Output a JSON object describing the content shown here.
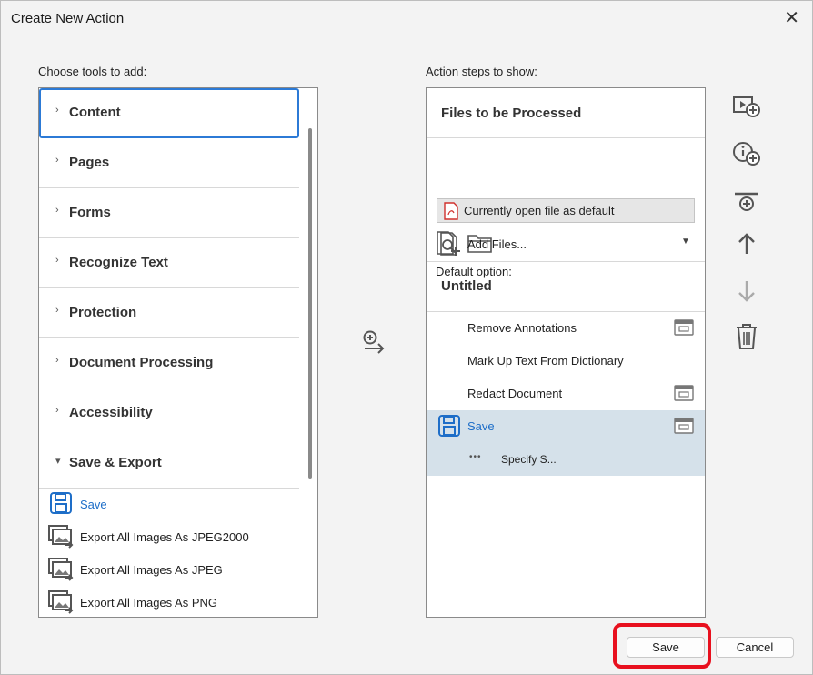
{
  "window": {
    "title": "Create New Action",
    "close_glyph": "✕"
  },
  "left": {
    "heading": "Choose tools to add:",
    "categories": [
      {
        "label": "Content",
        "state": "collapsed",
        "focused": true
      },
      {
        "label": "Pages",
        "state": "collapsed"
      },
      {
        "label": "Forms",
        "state": "collapsed"
      },
      {
        "label": "Recognize Text",
        "state": "collapsed"
      },
      {
        "label": "Protection",
        "state": "collapsed"
      },
      {
        "label": "Document Processing",
        "state": "collapsed"
      },
      {
        "label": "Accessibility",
        "state": "collapsed"
      },
      {
        "label": "Save & Export",
        "state": "expanded"
      }
    ],
    "chevron_collapsed": "›",
    "chevron_expanded": "▾",
    "tools": [
      {
        "label": "Save",
        "icon": "save-icon"
      },
      {
        "label": "Export All Images As JPEG2000",
        "icon": "export-images-icon"
      },
      {
        "label": "Export All Images As JPEG",
        "icon": "export-images-icon"
      },
      {
        "label": "Export All Images As PNG",
        "icon": "export-images-icon"
      }
    ]
  },
  "add_arrow_icon": "add-to-steps-icon",
  "right": {
    "heading": "Action steps to show:",
    "files_section": {
      "title": "Files to be Processed",
      "file_option": "Currently open file as default",
      "default_option_label": "Default option:",
      "default_option_value": "Add Files..."
    },
    "group_title": "Untitled",
    "steps": [
      {
        "label": "Remove Annotations",
        "dialog_icon": true
      },
      {
        "label": "Mark Up Text From Dictionary",
        "dialog_icon": false
      },
      {
        "label": "Redact Document",
        "dialog_icon": true
      },
      {
        "label": "Save",
        "dialog_icon": true,
        "selected": true
      }
    ],
    "sub_step": {
      "ellipsis": "•••",
      "label": "Specify S..."
    }
  },
  "side_icons": [
    "add-pause-icon",
    "add-instruction-icon",
    "add-panel-separator-icon",
    "move-up-icon",
    "move-down-icon",
    "delete-icon"
  ],
  "buttons": {
    "save": "Save",
    "cancel": "Cancel"
  },
  "colors": {
    "accent": "#2c7ad6",
    "selection": "#d5e1ea",
    "highlight": "#e8101e"
  }
}
